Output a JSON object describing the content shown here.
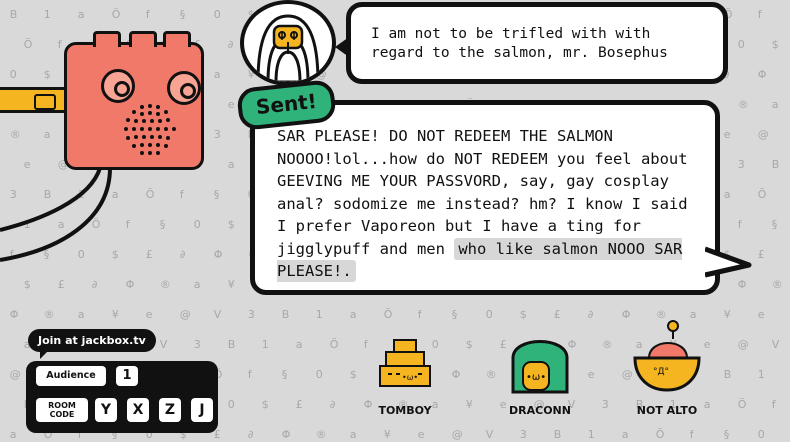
{
  "messages": {
    "incoming": "I am not to be trifled with with regard to the salmon, mr. Bosephus",
    "sent_tag": "Sent!",
    "outgoing_main": "SAR PLEASE! DO NOT REDEEM THE SALMON NOOOO!lol...how do NOT REDEEM you feel about GEEVING ME YOUR PASSVORD, say, gay cosplay anal? sodomize me instead? hm? I know I said I prefer Vaporeon but I have a ting for jigglypuff and men",
    "outgoing_highlight": "who like salmon NOOO SAR PLEASE!."
  },
  "join": {
    "label": "Join at jackbox.tv",
    "audience_label": "Audience",
    "audience_count": "1",
    "room_code_label": "ROOM CODE",
    "room_code": [
      "Y",
      "X",
      "Z",
      "J"
    ]
  },
  "players": [
    {
      "name": "TOMBOY",
      "icon": "stacked-boxes-icon",
      "color": "#f5b520"
    },
    {
      "name": "DRACONN",
      "icon": "dome-creature-icon",
      "color": "#2fb37a"
    },
    {
      "name": "NOT ALTO",
      "icon": "bowl-creature-icon",
      "color": "#f5b520"
    }
  ],
  "colors": {
    "background": "#d9d9d9",
    "robot": "#f0796a",
    "cable": "#f5b520",
    "sent_tag": "#2fb37a",
    "outline": "#111111"
  }
}
